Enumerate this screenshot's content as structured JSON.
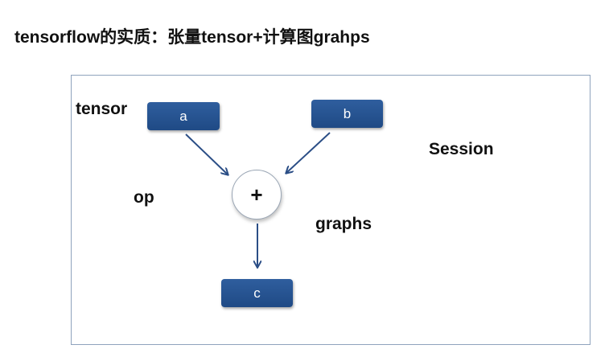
{
  "title": "tensorflow的实质：张量tensor+计算图grahps",
  "diagram": {
    "labels": {
      "tensor": "tensor",
      "op": "op",
      "graphs": "graphs",
      "session": "Session"
    },
    "nodes": {
      "a": "a",
      "b": "b",
      "op": "+",
      "c": "c"
    },
    "colors": {
      "node_fill": "#2a5696",
      "frame_border": "#8fa3bd",
      "arrow": "#2b4e86"
    }
  }
}
